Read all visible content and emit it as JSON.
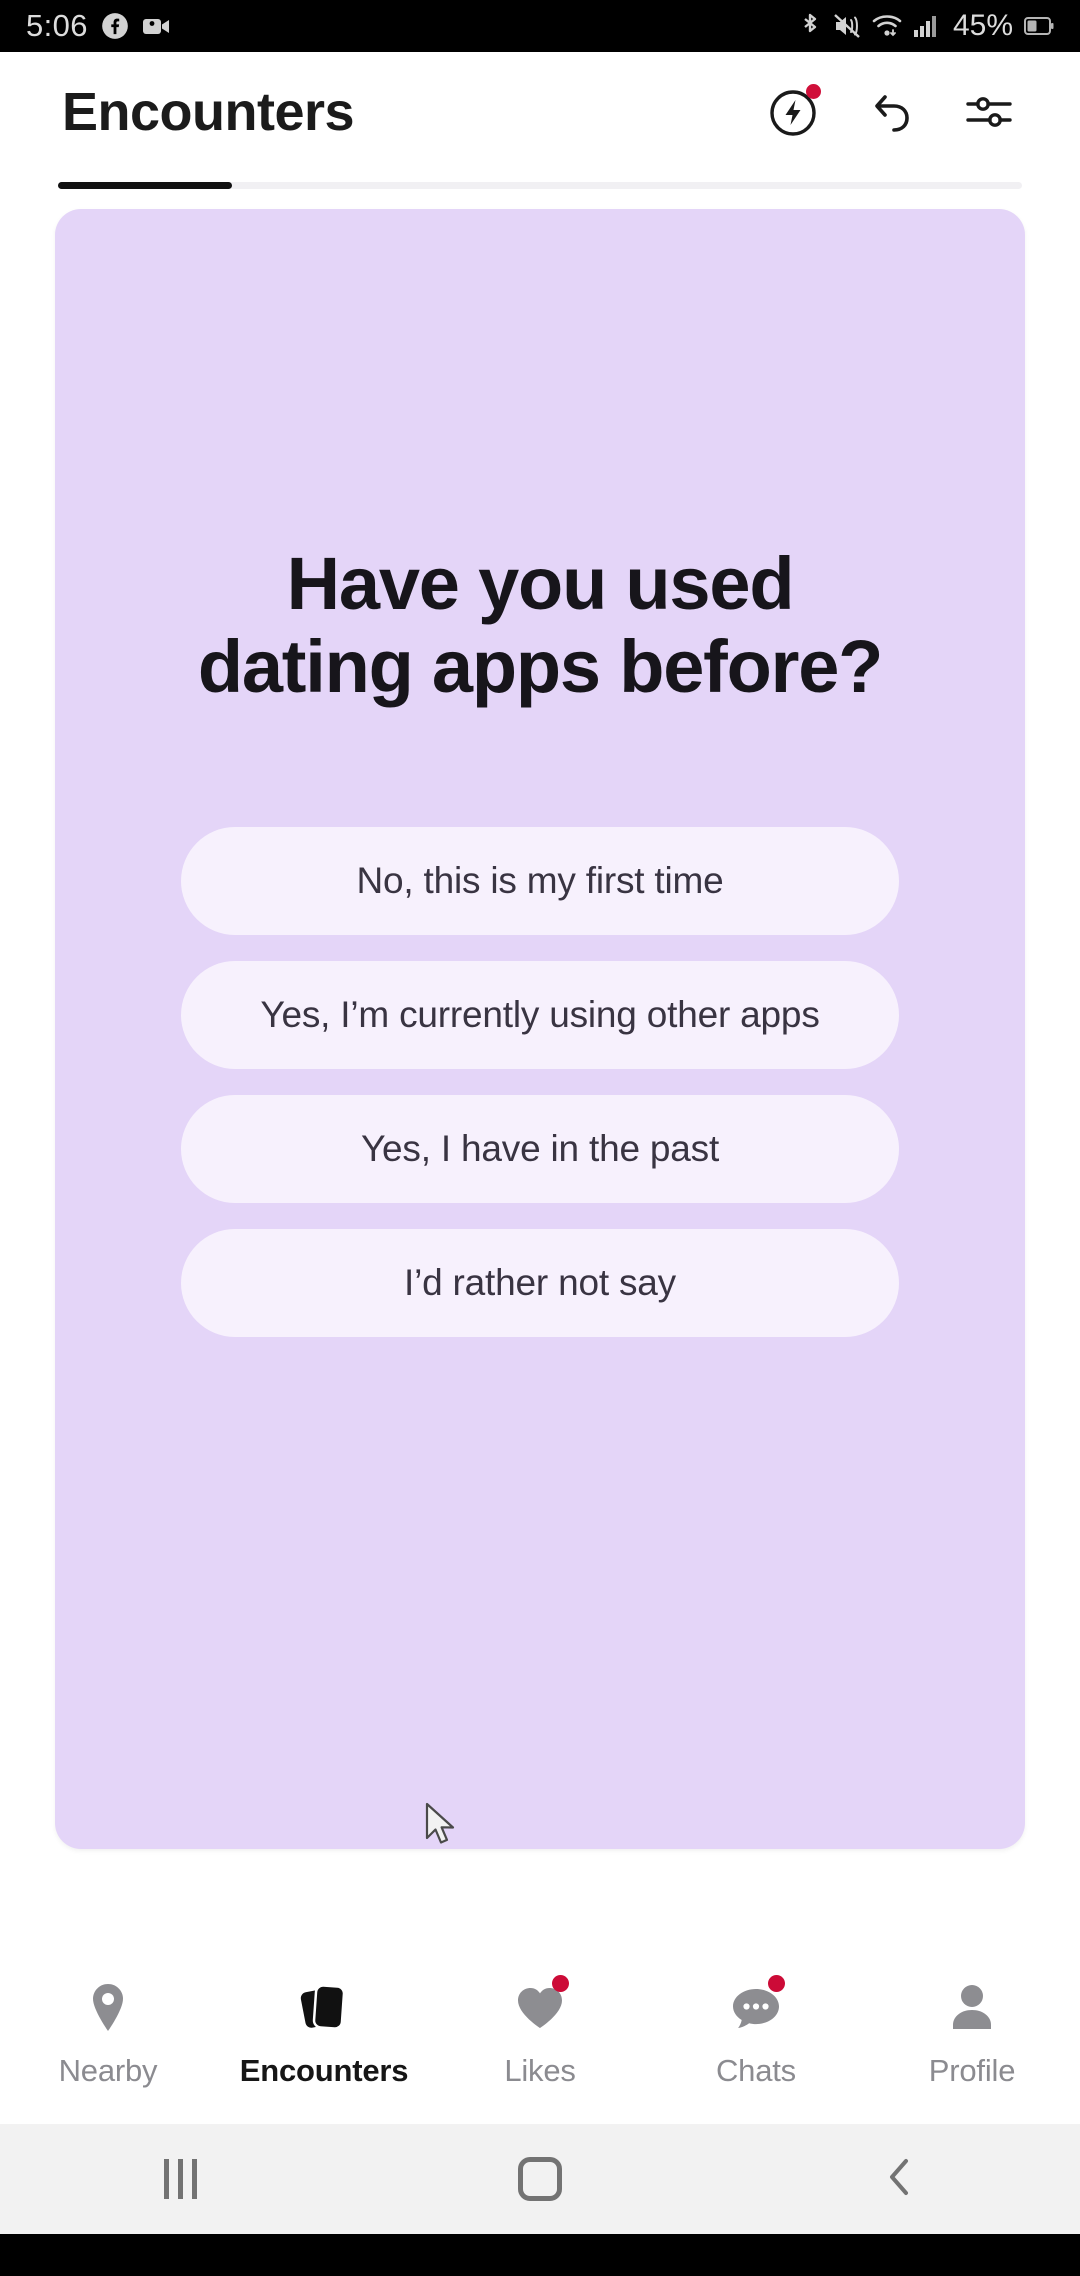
{
  "statusbar": {
    "time": "5:06",
    "battery": "45%",
    "left_icons": [
      "facebook-icon",
      "video-camera-icon"
    ],
    "right_icons": [
      "bluetooth-icon",
      "mute-icon",
      "wifi-icon",
      "cellular-signal-icon",
      "battery-icon"
    ]
  },
  "header": {
    "title": "Encounters",
    "actions": [
      {
        "name": "boost-icon",
        "has_badge": true
      },
      {
        "name": "undo-icon",
        "has_badge": false
      },
      {
        "name": "filter-sliders-icon",
        "has_badge": false
      }
    ]
  },
  "progress": {
    "percent": 18
  },
  "card": {
    "background": "#e4d5f8",
    "question": "Have you used dating apps before?",
    "answers": [
      "No, this is my first time",
      "Yes, I’m currently using other apps",
      "Yes, I have in the past",
      "I’d rather not say"
    ]
  },
  "bottom_nav": {
    "items": [
      {
        "label": "Nearby",
        "icon": "location-pin-icon",
        "active": false,
        "badge": false
      },
      {
        "label": "Encounters",
        "icon": "stacked-cards-icon",
        "active": true,
        "badge": false
      },
      {
        "label": "Likes",
        "icon": "heart-icon",
        "active": false,
        "badge": true
      },
      {
        "label": "Chats",
        "icon": "chat-bubble-icon",
        "active": false,
        "badge": true
      },
      {
        "label": "Profile",
        "icon": "person-icon",
        "active": false,
        "badge": false
      }
    ],
    "badge_color": "#cc0b37"
  },
  "system_nav": {
    "buttons": [
      "recents-button",
      "home-button",
      "back-button"
    ]
  }
}
